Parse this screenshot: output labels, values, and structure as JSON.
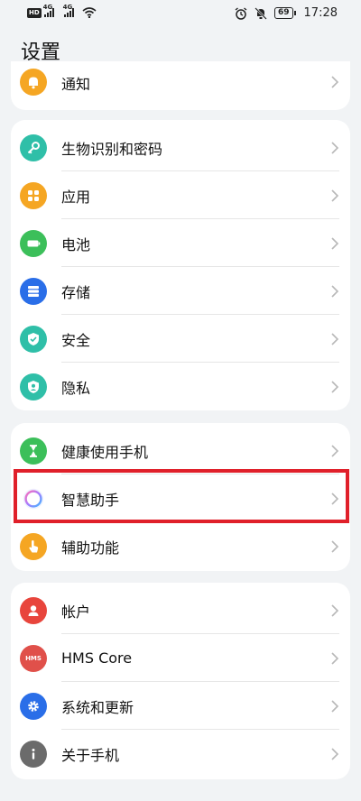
{
  "status_bar": {
    "hd_badge": "HD",
    "signal1_gen": "4G",
    "signal2_gen": "4G",
    "battery": "69",
    "time": "17:28"
  },
  "page": {
    "title": "设置"
  },
  "sections": [
    {
      "items": [
        {
          "label": "通知",
          "icon": "bell-icon",
          "color": "#f5a623"
        }
      ]
    },
    {
      "items": [
        {
          "label": "生物识别和密码",
          "icon": "key-icon",
          "color": "#2fbfa8"
        },
        {
          "label": "应用",
          "icon": "apps-grid-icon",
          "color": "#f5a623"
        },
        {
          "label": "电池",
          "icon": "battery-icon",
          "color": "#3cbf5a"
        },
        {
          "label": "存储",
          "icon": "storage-icon",
          "color": "#2a6ee8"
        },
        {
          "label": "安全",
          "icon": "shield-icon",
          "color": "#2fbfa8"
        },
        {
          "label": "隐私",
          "icon": "privacy-icon",
          "color": "#2fbfa8"
        }
      ]
    },
    {
      "items": [
        {
          "label": "健康使用手机",
          "icon": "hourglass-icon",
          "color": "#3cbf5a"
        },
        {
          "label": "智慧助手",
          "icon": "assistant-ring-icon",
          "color": "#ffffff"
        },
        {
          "label": "辅助功能",
          "icon": "hand-icon",
          "color": "#f5a623"
        }
      ]
    },
    {
      "items": [
        {
          "label": "帐户",
          "icon": "user-icon",
          "color": "#e8453c"
        },
        {
          "label": "HMS Core",
          "icon": "hms-icon",
          "color": "#e0504a"
        },
        {
          "label": "系统和更新",
          "icon": "gear-icon",
          "color": "#2a6ee8"
        },
        {
          "label": "关于手机",
          "icon": "info-icon",
          "color": "#6b6b6b"
        }
      ]
    }
  ],
  "hms_icon_text": "HMS",
  "highlight_color": "#e0202a"
}
